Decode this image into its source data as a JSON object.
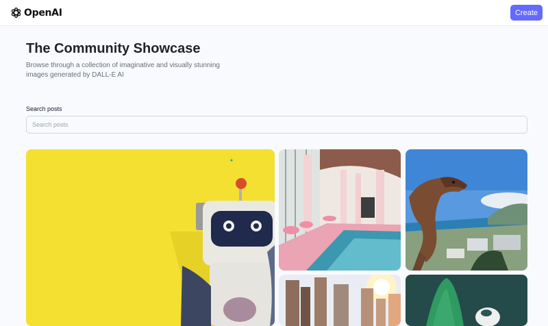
{
  "header": {
    "logo_text": "OpenAI",
    "create_label": "Create"
  },
  "hero": {
    "title": "The Community Showcase",
    "subtitle": "Browse through a collection of imaginative and visually stunning images generated by DALL-E AI"
  },
  "search": {
    "label": "Search posts",
    "placeholder": "Search posts",
    "value": ""
  },
  "gallery": {
    "cards": [
      {
        "subject": "toy robot on yellow background"
      },
      {
        "subject": "pink indoor pool architecture"
      },
      {
        "subject": "dinosaur toy over coastal city"
      },
      {
        "subject": "sunlit skyscrapers"
      },
      {
        "subject": "green cone figure and toy"
      }
    ]
  },
  "colors": {
    "accent": "#6469ff",
    "title": "#222328",
    "subtitle": "#666e75",
    "page_background": "#f9fafe"
  }
}
